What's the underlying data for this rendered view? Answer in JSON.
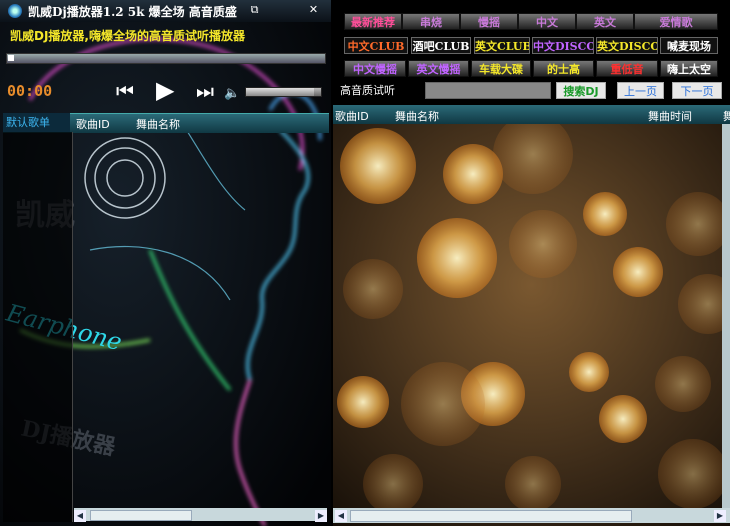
{
  "player": {
    "title": "凯威Dj播放器1.2  5k 爆全场 高音质盛",
    "slogan": "凯威DJ播放器,嗨爆全场的高音质试听播放器",
    "time": "00:00",
    "progress": 0,
    "volume": 0.9,
    "win_buttons": {
      "restore": "⧉",
      "close": "✕"
    },
    "icons": {
      "prev": "⏮",
      "play": "▶",
      "next": "⏭",
      "volume": "🔈"
    },
    "playlist": {
      "tab_label": "默认歌单",
      "columns": {
        "id": "歌曲ID",
        "name": "舞曲名称"
      }
    },
    "watermarks": {
      "brand": "凯威",
      "earphone": "Earphone",
      "dj": "DJ播放器"
    }
  },
  "browser": {
    "categories_row1": [
      {
        "label": "最新推荐",
        "color": "#ff4f9a"
      },
      {
        "label": "串烧",
        "color": "#c87ad8"
      },
      {
        "label": "慢摇",
        "color": "#c87ad8"
      },
      {
        "label": "中文",
        "color": "#c87ad8"
      },
      {
        "label": "英文",
        "color": "#c87ad8"
      },
      {
        "label": "爱情歌",
        "color": "#c87ad8"
      }
    ],
    "categories_row2": [
      {
        "label": "中文CLUB",
        "color": "#ff6a2a"
      },
      {
        "label": "酒吧CLUB",
        "color": "#ffffff"
      },
      {
        "label": "英文CLUB",
        "color": "#f4e72a"
      },
      {
        "label": "中文DISCO",
        "color": "#c064ff"
      },
      {
        "label": "英文DISCO",
        "color": "#f4e72a"
      },
      {
        "label": "喊麦现场",
        "color": "#ffffff"
      }
    ],
    "categories_row3": [
      {
        "label": "中文慢摇",
        "color": "#c064ff"
      },
      {
        "label": "英文慢摇",
        "color": "#c064ff"
      },
      {
        "label": "车载大碟",
        "color": "#f4e72a"
      },
      {
        "label": "的士高",
        "color": "#f4e72a"
      },
      {
        "label": "重低音",
        "color": "#ff3030"
      },
      {
        "label": "嗨上太空",
        "color": "#ffffff"
      }
    ],
    "hq_label": "高音质试听",
    "search_value": "",
    "search_button": "搜索DJ",
    "prev_page": "上一页",
    "next_page": "下一页",
    "columns": {
      "id": "歌曲ID",
      "name": "舞曲名称",
      "time": "舞曲时间",
      "more": "舞"
    }
  }
}
